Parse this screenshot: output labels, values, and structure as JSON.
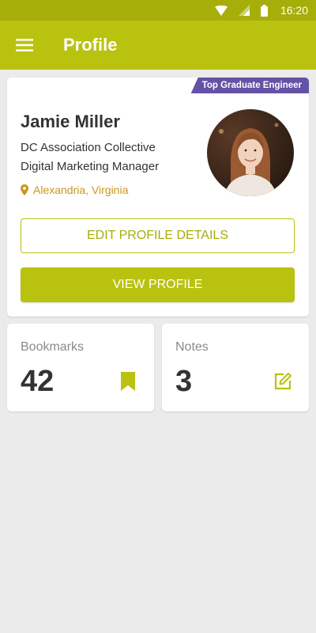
{
  "status_bar": {
    "time": "16:20",
    "icons": [
      "wifi-icon",
      "signal-icon",
      "battery-icon"
    ]
  },
  "app_bar": {
    "title": "Profile",
    "menu_icon": "hamburger-menu-icon"
  },
  "profile": {
    "badge": "Top Graduate Engineer",
    "name": "Jamie Miller",
    "organization": "DC Association Collective",
    "role": "Digital Marketing Manager",
    "location": "Alexandria, Virginia",
    "location_icon": "map-pin-icon",
    "avatar": "profile-photo",
    "edit_button": "EDIT PROFILE DETAILS",
    "view_button": "VIEW PROFILE"
  },
  "stats": {
    "bookmarks": {
      "label": "Bookmarks",
      "value": "42",
      "icon": "bookmark-icon"
    },
    "notes": {
      "label": "Notes",
      "value": "3",
      "icon": "edit-note-icon"
    }
  },
  "colors": {
    "primary": "#b9c20f",
    "primary_dark": "#a6ae09",
    "badge": "#6452a6",
    "location": "#c9961a",
    "background": "#ebebeb"
  }
}
